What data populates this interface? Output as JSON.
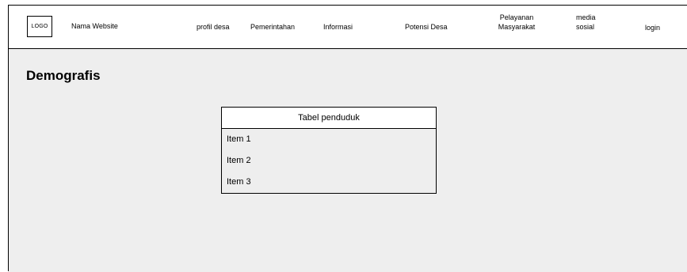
{
  "header": {
    "logo_text": "LOGO",
    "site_name": "Nama Website",
    "nav": {
      "profil_desa": "profil desa",
      "pemerintahan": "Pemerintahan",
      "informasi": "Informasi",
      "potensi_desa": "Potensi Desa",
      "pelayanan_line1": "Pelayanan",
      "pelayanan_line2": "Masyarakat",
      "media_line1": "media",
      "media_line2": "sosial",
      "login": "login"
    }
  },
  "main": {
    "title": "Demografis",
    "table": {
      "header": "Tabel penduduk",
      "items": [
        "Item 1",
        "Item 2",
        "Item 3"
      ]
    }
  },
  "colors": {
    "content_background": "#eeeeee",
    "header_background": "#ffffff",
    "border": "#000000"
  }
}
